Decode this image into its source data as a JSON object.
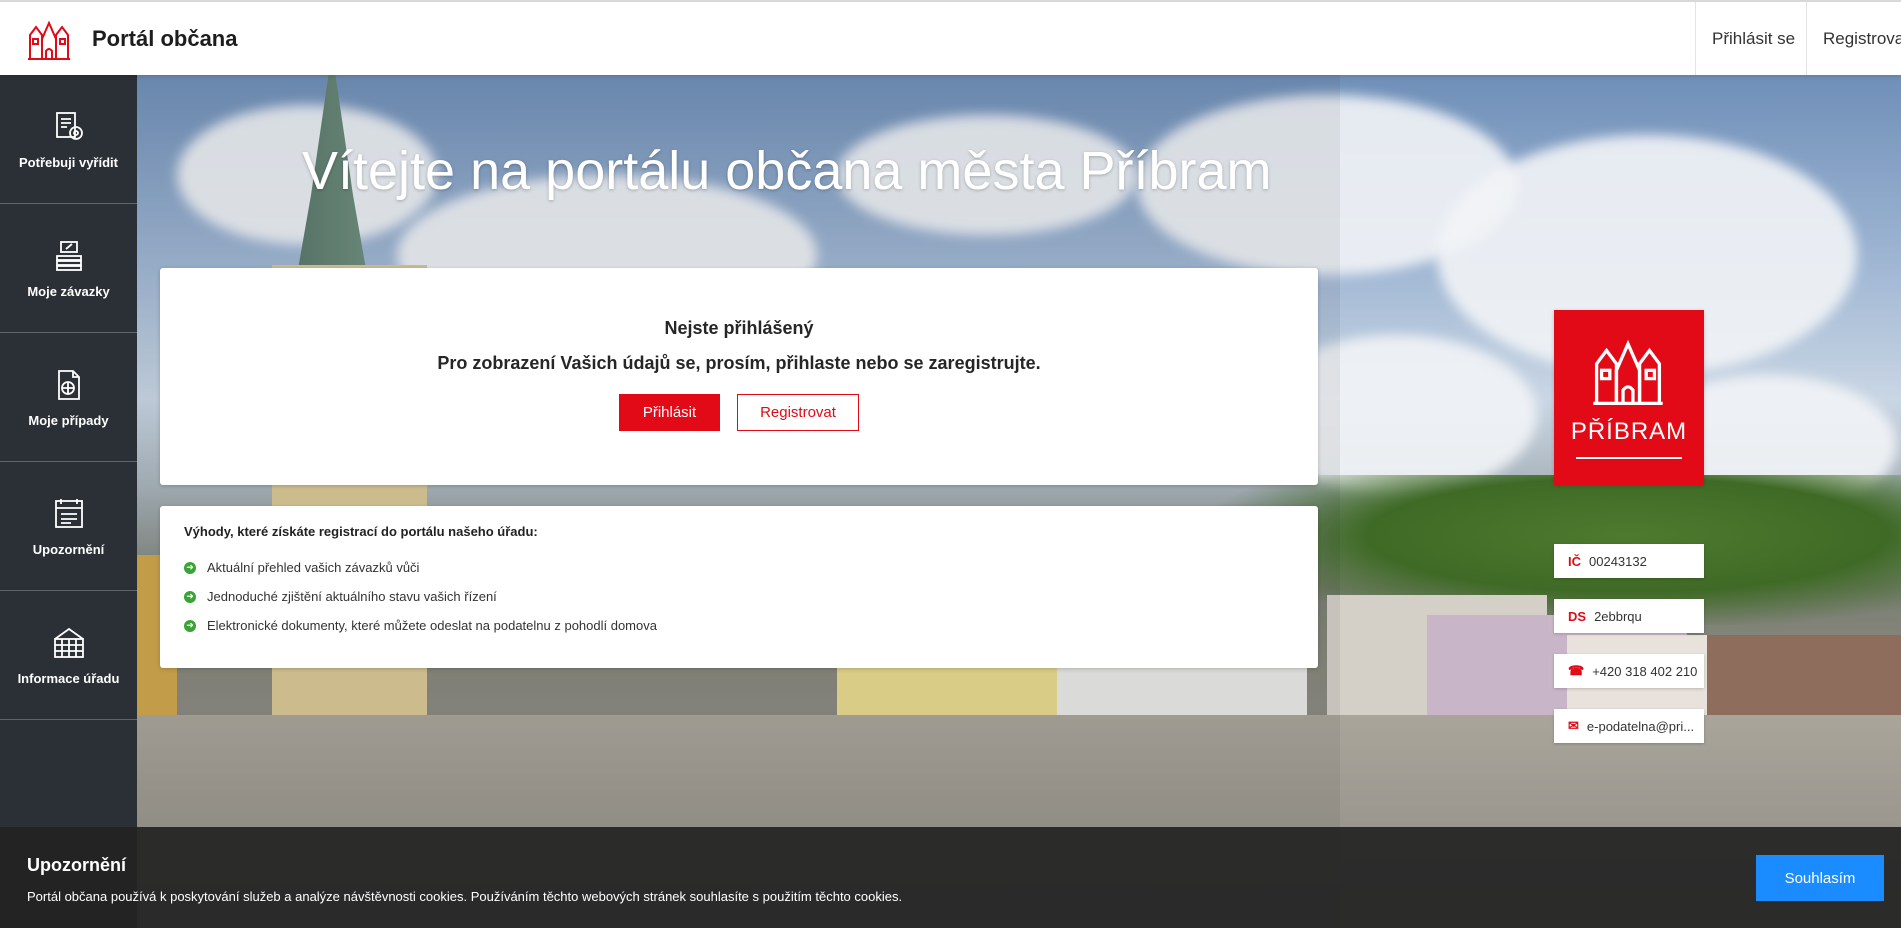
{
  "header": {
    "app_title": "Portál občana",
    "login_label": "Přihlásit se",
    "register_label": "Registrovat"
  },
  "sidebar": {
    "items": [
      {
        "label": "Potřebuji vyřídit",
        "icon": "document-gear-icon"
      },
      {
        "label": "Moje závazky",
        "icon": "money-stack-icon"
      },
      {
        "label": "Moje případy",
        "icon": "folder-case-icon"
      },
      {
        "label": "Upozornění",
        "icon": "calendar-icon"
      },
      {
        "label": "Informace úřadu",
        "icon": "building-icon"
      }
    ]
  },
  "hero": {
    "title": "Vítejte na portálu občana města Příbram"
  },
  "login_card": {
    "title": "Nejste přihlášený",
    "subtitle": "Pro zobrazení Vašich údajů se, prosím, přihlaste nebo se zaregistrujte.",
    "login_button": "Přihlásit",
    "register_button": "Registrovat"
  },
  "benefits": {
    "title": "Výhody, které získáte registrací do portálu našeho úřadu:",
    "items": [
      "Aktuální přehled vašich závazků vůči",
      "Jednoduché zjištění aktuálního stavu vašich řízení",
      "Elektronické dokumenty, které můžete odeslat na podatelnu z pohodlí domova"
    ]
  },
  "city": {
    "name": "PŘÍBRAM",
    "ic_label": "IČ",
    "ic_value": "00243132",
    "ds_label": "DS",
    "ds_value": "2ebbrqu",
    "phone": "+420 318 402 210",
    "email": "e-podatelna@pri..."
  },
  "cookie": {
    "title": "Upozornění",
    "text": "Portál občana používá k poskytování služeb a analýze návštěvnosti cookies. Používáním těchto webových stránek souhlasíte s použitím těchto cookies.",
    "accept_button": "Souhlasím"
  },
  "colors": {
    "brand_red": "#e20a17",
    "sidebar_bg": "#2a3036",
    "accept_blue": "#1a8cff",
    "check_green": "#3aa335"
  }
}
